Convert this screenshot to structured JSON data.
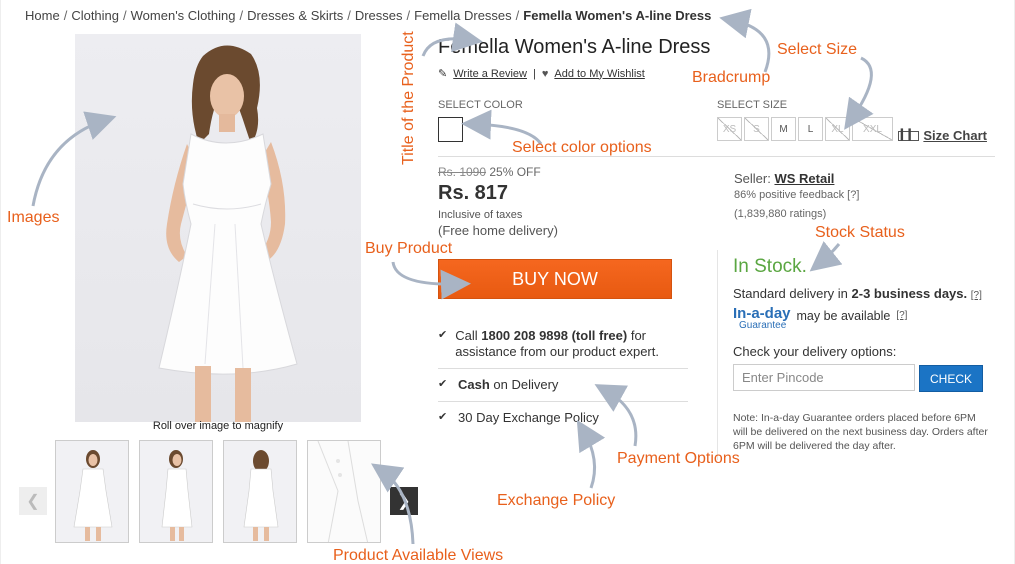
{
  "breadcrumb": {
    "items": [
      "Home",
      "Clothing",
      "Women's Clothing",
      "Dresses & Skirts",
      "Dresses",
      "Femella Dresses"
    ],
    "current": "Femella Women's A-line Dress",
    "separator": "/"
  },
  "gallery": {
    "magnify_hint": "Roll over image to magnify",
    "thumbnail_count": 4
  },
  "product": {
    "title": "Femella Women's A-line Dress",
    "write_review": "Write a Review",
    "review_separator": "|",
    "add_wishlist": "Add to My Wishlist",
    "select_color_label": "SELECT COLOR",
    "select_size_label": "SELECT SIZE",
    "sizes": [
      {
        "label": "XS",
        "available": false
      },
      {
        "label": "S",
        "available": false
      },
      {
        "label": "M",
        "available": true
      },
      {
        "label": "L",
        "available": true
      },
      {
        "label": "XL",
        "available": false
      },
      {
        "label": "XXL",
        "available": false
      }
    ],
    "size_chart": "Size Chart",
    "mrp": "Rs. 1090",
    "discount": "25% OFF",
    "price": "Rs. 817",
    "tax_note": "Inclusive of taxes",
    "free_delivery": "(Free home delivery)",
    "buy_now": "BUY NOW"
  },
  "benefits": {
    "call_pre": "Call ",
    "call_number": "1800 208 9898 (toll free)",
    "call_post": " for assistance from our product expert.",
    "cod_bold": "Cash",
    "cod_rest": " on Delivery",
    "exchange": "30 Day Exchange Policy"
  },
  "seller": {
    "label": "Seller: ",
    "name": "WS Retail",
    "feedback": "86% positive feedback",
    "help": "[?]",
    "ratings": "(1,839,880 ratings)"
  },
  "delivery": {
    "stock_status": "In Stock.",
    "std_pre": "Standard delivery in ",
    "std_bold": "2-3 business days.",
    "help": "[?]",
    "inaday_logo_1": "In-a-day",
    "inaday_logo_2": "Guarantee",
    "inaday_text": "may be available",
    "check_options": "Check your delivery options:",
    "pincode_placeholder": "Enter Pincode",
    "check_button": "CHECK",
    "note": "Note: In-a-day Guarantee orders placed before 6PM will be delivered on the next business day. Orders after 6PM will be delivered the day after."
  },
  "annotations": {
    "images": "Images",
    "title_of_product": "Title of the Product",
    "bradcrump": "Bradcrump",
    "select_size": "Select Size",
    "select_color_options": "Select color options",
    "buy_product": "Buy Product",
    "stock_status": "Stock Status",
    "payment_options": "Payment Options",
    "exchange_policy": "Exchange Policy",
    "product_available_views": "Product Available Views"
  },
  "colors": {
    "annotation": "#e8601c",
    "buy_button": "#f5671f",
    "check_button": "#1b74c5",
    "in_stock": "#5aa641",
    "inaday_blue": "#2a6fb7"
  }
}
